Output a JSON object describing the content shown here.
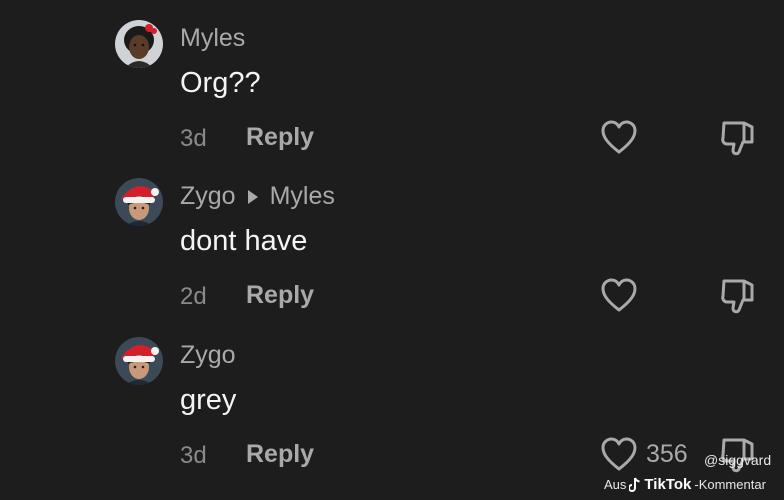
{
  "comments": [
    {
      "author": "Myles",
      "reply_to": "",
      "text": "Org??",
      "age": "3d",
      "reply_label": "Reply",
      "likes": "",
      "avatar_icon": "person-red-bow-avatar"
    },
    {
      "author": "Zygo",
      "reply_to": "Myles",
      "text": "dont have",
      "age": "2d",
      "reply_label": "Reply",
      "likes": "",
      "avatar_icon": "person-santa-hat-avatar"
    },
    {
      "author": "Zygo",
      "reply_to": "",
      "text": "grey",
      "age": "3d",
      "reply_label": "Reply",
      "likes": "356",
      "avatar_icon": "person-santa-hat-avatar"
    }
  ],
  "watermark": {
    "handle": "@siggvard",
    "prefix": "Aus",
    "brand": "TikTok",
    "suffix": "-Kommentar"
  },
  "colors": {
    "background": "#1d1d1d",
    "author": "#a9a9a9",
    "text": "#f4f4f4",
    "meta": "#8a8a8a",
    "santa_red": "#d41f2a"
  }
}
